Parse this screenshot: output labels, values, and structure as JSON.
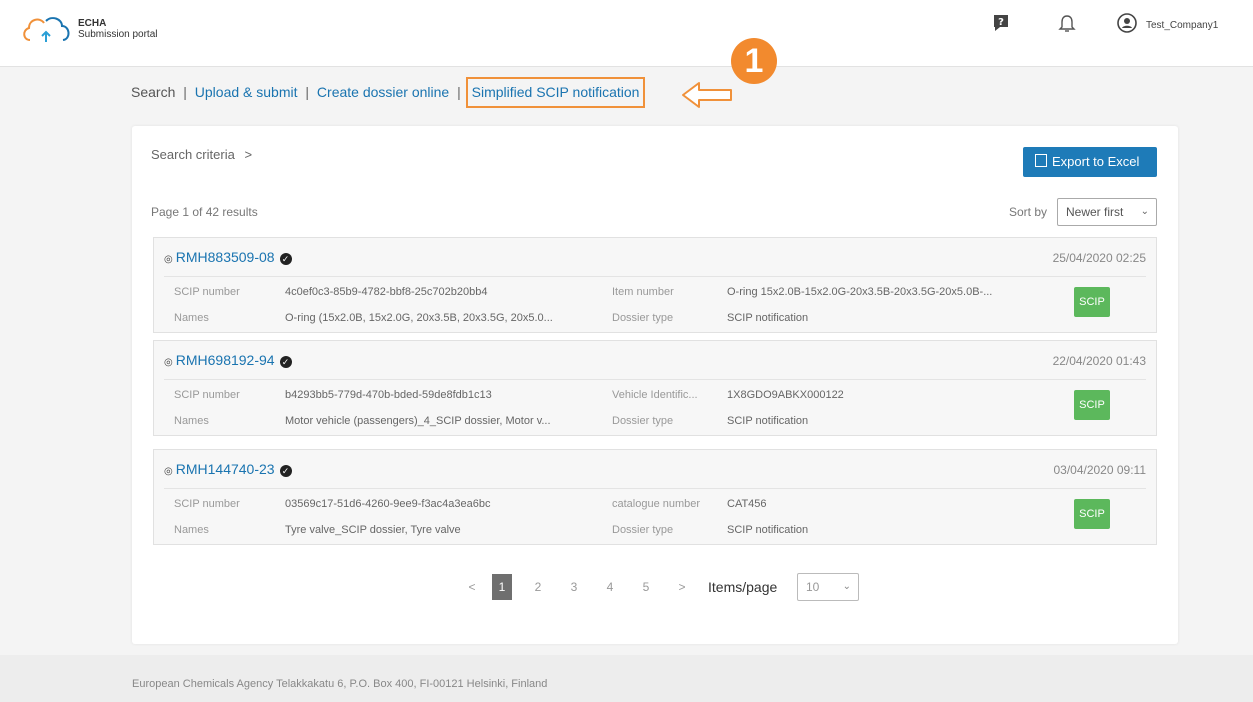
{
  "header": {
    "logo_line1": "ECHA",
    "logo_line2": "Submission portal",
    "user_name": "Test_Company1"
  },
  "nav": {
    "search": "Search",
    "upload": "Upload & submit",
    "create": "Create dossier online",
    "simplified": "Simplified SCIP notification",
    "separator": "|",
    "callout_number": "1"
  },
  "toolbar": {
    "search_criteria": "Search criteria",
    "export_label": "Export to Excel",
    "page_info": "Page 1 of 42 results",
    "sort_label": "Sort by",
    "sort_value": "Newer first"
  },
  "results": [
    {
      "id": "RMH883509-08",
      "date": "25/04/2020 02:25",
      "scip_label": "SCIP number",
      "scip_value": "4c0ef0c3-85b9-4782-bbf8-25c702b20bb4",
      "names_label": "Names",
      "names_value": "O-ring (15x2.0B, 15x2.0G, 20x3.5B, 20x3.5G, 20x5.0...",
      "field_label": "Item number",
      "field_value": "O-ring 15x2.0B-15x2.0G-20x3.5B-20x3.5G-20x5.0B-...",
      "dossier_label": "Dossier type",
      "dossier_value": "SCIP notification",
      "badge": "SCIP"
    },
    {
      "id": "RMH698192-94",
      "date": "22/04/2020 01:43",
      "scip_label": "SCIP number",
      "scip_value": "b4293bb5-779d-470b-bded-59de8fdb1c13",
      "names_label": "Names",
      "names_value": "Motor vehicle (passengers)_4_SCIP dossier, Motor v...",
      "field_label": "Vehicle Identific...",
      "field_value": "1X8GDO9ABKX000122",
      "dossier_label": "Dossier type",
      "dossier_value": "SCIP notification",
      "badge": "SCIP"
    },
    {
      "id": "RMH144740-23",
      "date": "03/04/2020 09:11",
      "scip_label": "SCIP number",
      "scip_value": "03569c17-51d6-4260-9ee9-f3ac4a3ea6bc",
      "names_label": "Names",
      "names_value": "Tyre valve_SCIP dossier, Tyre valve",
      "field_label": "catalogue number",
      "field_value": "CAT456",
      "dossier_label": "Dossier type",
      "dossier_value": "SCIP notification",
      "badge": "SCIP"
    }
  ],
  "pagination": {
    "prev": "<",
    "pages": [
      "1",
      "2",
      "3",
      "4",
      "5"
    ],
    "next": ">",
    "items_label": "Items/page",
    "items_value": "10"
  },
  "footer": {
    "text": "European Chemicals Agency Telakkakatu 6, P.O. Box 400, FI-00121 Helsinki, Finland"
  },
  "colors": {
    "link": "#1a74b0",
    "export_button": "#1e7bb8",
    "badge": "#5cb85c",
    "callout": "#f28a2e"
  }
}
